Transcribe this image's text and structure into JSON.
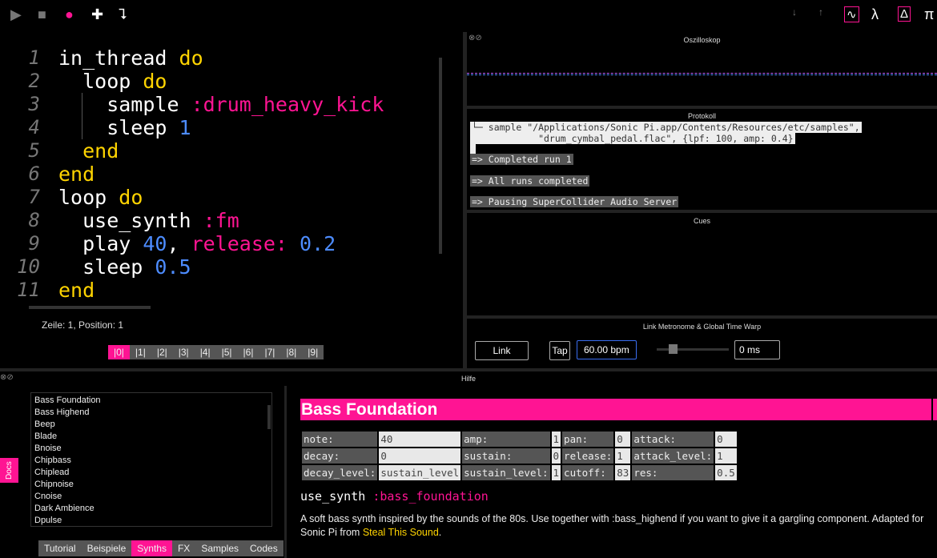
{
  "toolbar": {
    "left": [
      {
        "name": "play-icon",
        "g": "▶",
        "c": "#777"
      },
      {
        "name": "stop-icon",
        "g": "■",
        "c": "#777"
      },
      {
        "name": "record-icon",
        "g": "●",
        "c": "#ff1493"
      },
      {
        "name": "plus-icon",
        "g": "✚",
        "c": "#fff"
      },
      {
        "name": "return-icon",
        "g": "⮧",
        "c": "#fff"
      }
    ],
    "right": [
      {
        "name": "arrow-down-icon",
        "g": "↓",
        "c": "#777"
      },
      {
        "name": "arrow-up-icon",
        "g": "↑",
        "c": "#777"
      },
      {
        "name": "scope-icon",
        "g": "∿",
        "c": "#fff"
      },
      {
        "name": "lambda-icon",
        "g": "λ",
        "c": "#fff"
      },
      {
        "name": "delta-icon",
        "g": "Δ",
        "c": "#fff"
      },
      {
        "name": "pi-icon",
        "g": "π",
        "c": "#fff"
      }
    ]
  },
  "editor": {
    "lines": [
      [
        [
          "in_thread ",
          "w"
        ],
        [
          "do",
          "k"
        ]
      ],
      [
        [
          "  loop ",
          "w"
        ],
        [
          "do",
          "k"
        ]
      ],
      [
        [
          "    sample ",
          "w"
        ],
        [
          ":drum_heavy_kick",
          "s"
        ]
      ],
      [
        [
          "    sleep ",
          "w"
        ],
        [
          "1",
          "n"
        ]
      ],
      [
        [
          "  end",
          "k"
        ]
      ],
      [
        [
          "end",
          "k"
        ]
      ],
      [
        [
          "loop ",
          "w"
        ],
        [
          "do",
          "k"
        ]
      ],
      [
        [
          "  use_synth ",
          "w"
        ],
        [
          ":fm",
          "s"
        ]
      ],
      [
        [
          "  play ",
          "w"
        ],
        [
          "40",
          "n"
        ],
        [
          ", ",
          "w"
        ],
        [
          "release: ",
          "s"
        ],
        [
          "0.2",
          "n"
        ]
      ],
      [
        [
          "  sleep ",
          "w"
        ],
        [
          "0.5",
          "n"
        ]
      ],
      [
        [
          "end",
          "k"
        ]
      ]
    ],
    "status": "Zeile: 1, Position: 1",
    "buffers": [
      "|0|",
      "|1|",
      "|2|",
      "|3|",
      "|4|",
      "|5|",
      "|6|",
      "|7|",
      "|8|",
      "|9|"
    ],
    "active_buffer": 0
  },
  "scope": {
    "title": "Oszilloskop"
  },
  "log": {
    "title": "Protokoll",
    "lines": [
      "└─ sample \"/Applications/Sonic Pi.app/Contents/Resources/etc/samples\",",
      "            \"drum_cymbal_pedal.flac\", {lpf: 100, amp: 0.4}",
      "=> Completed run 1",
      "=> All runs completed",
      "=> Pausing SuperCollider Audio Server"
    ]
  },
  "cues": {
    "title": "Cues"
  },
  "link": {
    "title": "Link Metronome & Global Time Warp",
    "link_label": "Link",
    "tap_label": "Tap",
    "bpm": "60.00 bpm",
    "time_warp": "0 ms",
    "slider": 0.1
  },
  "help": {
    "title": "Hilfe",
    "docs_label": "Docs",
    "list": [
      "Bass Foundation",
      "Bass Highend",
      "Beep",
      "Blade",
      "Bnoise",
      "Chipbass",
      "Chiplead",
      "Chipnoise",
      "Cnoise",
      "Dark Ambience",
      "Dpulse"
    ],
    "tabs": [
      "Tutorial",
      "Beispiele",
      "Synths",
      "FX",
      "Samples",
      "Codes"
    ],
    "active_tab": 2,
    "heading": "Bass Foundation",
    "params": [
      [
        "note:",
        "40",
        "amp:",
        "1",
        "pan:",
        "0",
        "attack:",
        "0"
      ],
      [
        "decay:",
        "0",
        "sustain:",
        "0",
        "release:",
        "1",
        "attack_level:",
        "1"
      ],
      [
        "decay_level:",
        "sustain_level",
        "sustain_level:",
        "1",
        "cutoff:",
        "83",
        "res:",
        "0.5"
      ]
    ],
    "use_synth": "use_synth",
    "synth_sym": ":bass_foundation",
    "desc": "A soft bass synth inspired by the sounds of the 80s. Use together with :bass_highend if you want to give it a gargling component. Adapted for Sonic Pi from ",
    "link_text": "Steal This Sound",
    "desc_end": "."
  },
  "colors": {
    "accent": "#ff1493",
    "keyword": "#ffd400",
    "number": "#4d8cff"
  }
}
